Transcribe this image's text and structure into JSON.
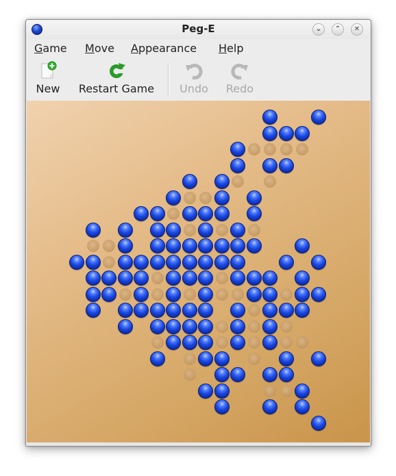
{
  "window": {
    "title": "Peg-E",
    "controls": [
      "minimize",
      "maximize",
      "close"
    ]
  },
  "menubar": {
    "items": [
      {
        "label_u": "G",
        "label_rest": "ame"
      },
      {
        "label_u": "M",
        "label_rest": "ove"
      },
      {
        "label_u": "A",
        "label_rest": "ppearance"
      },
      {
        "label_u": "H",
        "label_rest": "elp"
      }
    ]
  },
  "toolbar": {
    "new_label": "New",
    "restart_label": "Restart Game",
    "undo_label": "Undo",
    "redo_label": "Redo",
    "undo_enabled": false,
    "redo_enabled": false
  },
  "colors": {
    "peg": "#1a46dd",
    "board_light": "#f0d2ae",
    "board_dark": "#c9944a",
    "new_plus": "#2fb52f",
    "restart_green": "#2a9a2a"
  },
  "board": {
    "columns": 16,
    "rows": 20,
    "legend": {
      "P": "peg",
      "o": "empty-hole",
      ".": "none"
    },
    "grid": [
      "............P..P",
      "............PPP.",
      "..........Poooo.",
      "..........P.PP..",
      ".......P.Po.o...",
      "......PooP.P....",
      "....PPoPPP.P....",
      ".P.P.PPoPoPo....",
      ".ooP.PPPPPPP..P.",
      "PPoPPPPPPPP..P.P",
      ".PPPPoPPPoPPP.P.",
      ".PPoPoPoPooPPoPP",
      ".P.PPPPPP.PoPPP.",
      "...P.PPPPoPoPo..",
      ".....oPPPoPoPoo.",
      ".....P.oPP.o.P.P",
      ".......o.PP.PP..",
      "........PP..ooP.",
      ".........P..P.P.",
      "...............P"
    ]
  }
}
